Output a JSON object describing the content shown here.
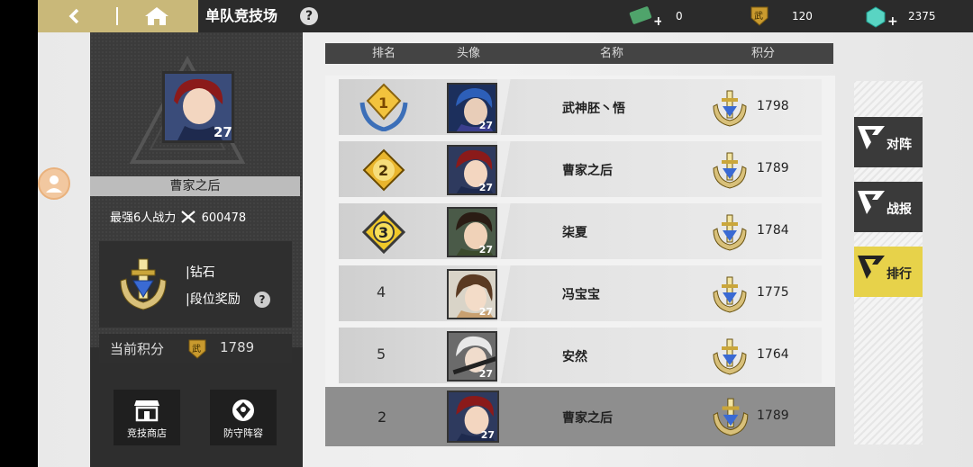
{
  "topbar": {
    "title": "单队竞技场",
    "help": "?",
    "resources": [
      {
        "icon": "cash-icon",
        "value": "0"
      },
      {
        "icon": "war-medal-icon",
        "value": "120"
      },
      {
        "icon": "diamond-icon",
        "value": "2375"
      }
    ]
  },
  "player": {
    "name": "曹家之后",
    "level": "27",
    "power_label": "最强6人战力",
    "power_value": "600478",
    "rank_name": "钻石",
    "rank_reward": "段位奖励",
    "score_label": "当前积分",
    "score_value": "1789",
    "medal_char": "武"
  },
  "bottom_buttons": [
    {
      "label": "竞技商店",
      "icon": "shop-icon"
    },
    {
      "label": "防守阵容",
      "icon": "defense-icon"
    }
  ],
  "table": {
    "headers": [
      "排名",
      "头像",
      "名称",
      "积分"
    ],
    "rows": [
      {
        "rank": "1",
        "name": "武神胚丶悟",
        "score": "1798",
        "level": "27",
        "medal": true
      },
      {
        "rank": "2",
        "name": "曹家之后",
        "score": "1789",
        "level": "27",
        "medal": true
      },
      {
        "rank": "3",
        "name": "柒夏",
        "score": "1784",
        "level": "27",
        "medal": true
      },
      {
        "rank": "4",
        "name": "冯宝宝",
        "score": "1775",
        "level": "27",
        "medal": false
      },
      {
        "rank": "5",
        "name": "安然",
        "score": "1764",
        "level": "27",
        "medal": false
      }
    ],
    "self": {
      "rank": "2",
      "name": "曹家之后",
      "score": "1789",
      "level": "27"
    }
  },
  "side_tabs": [
    {
      "label": "对阵",
      "active": false
    },
    {
      "label": "战报",
      "active": false
    },
    {
      "label": "排行",
      "active": true
    }
  ],
  "colors": {
    "gold": "#c9b879",
    "active_tab": "#e7d24a",
    "panel": "#3b3b3b"
  }
}
